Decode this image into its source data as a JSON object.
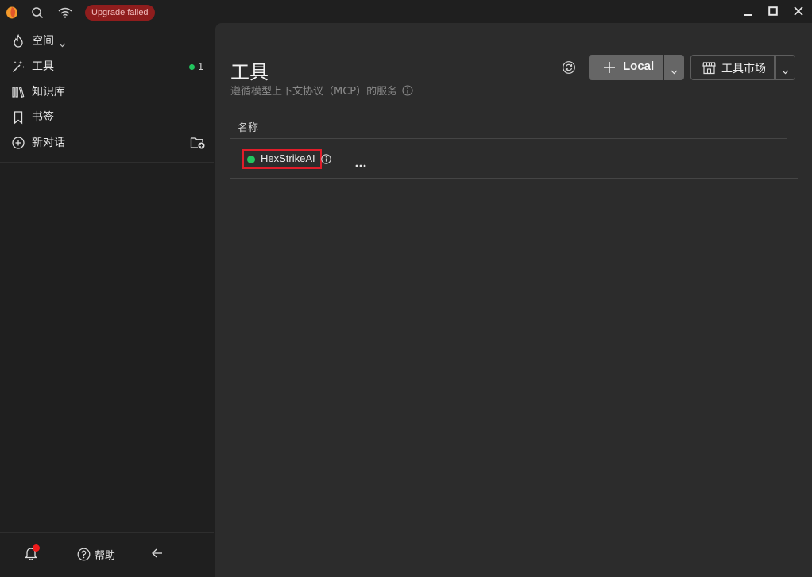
{
  "titlebar": {
    "status_badge": "Upgrade failed"
  },
  "sidebar": {
    "items": [
      {
        "label": "空间"
      },
      {
        "label": "工具",
        "count": "1"
      },
      {
        "label": "知识库"
      },
      {
        "label": "书签"
      },
      {
        "label": "新对话"
      }
    ],
    "footer": {
      "help_label": "帮助"
    }
  },
  "main": {
    "title": "工具",
    "subtitle": "遵循模型上下文协议（MCP）的服务",
    "local_button_label": "Local",
    "market_button_label": "工具市场",
    "table": {
      "column_name": "名称",
      "rows": [
        {
          "name": "HexStrikeAI",
          "status": "running",
          "status_color": "#22c55e"
        }
      ]
    }
  },
  "colors": {
    "accent_green": "#22c55e",
    "badge_red": "#8f1d1d",
    "highlight_red": "#e11d2a"
  }
}
